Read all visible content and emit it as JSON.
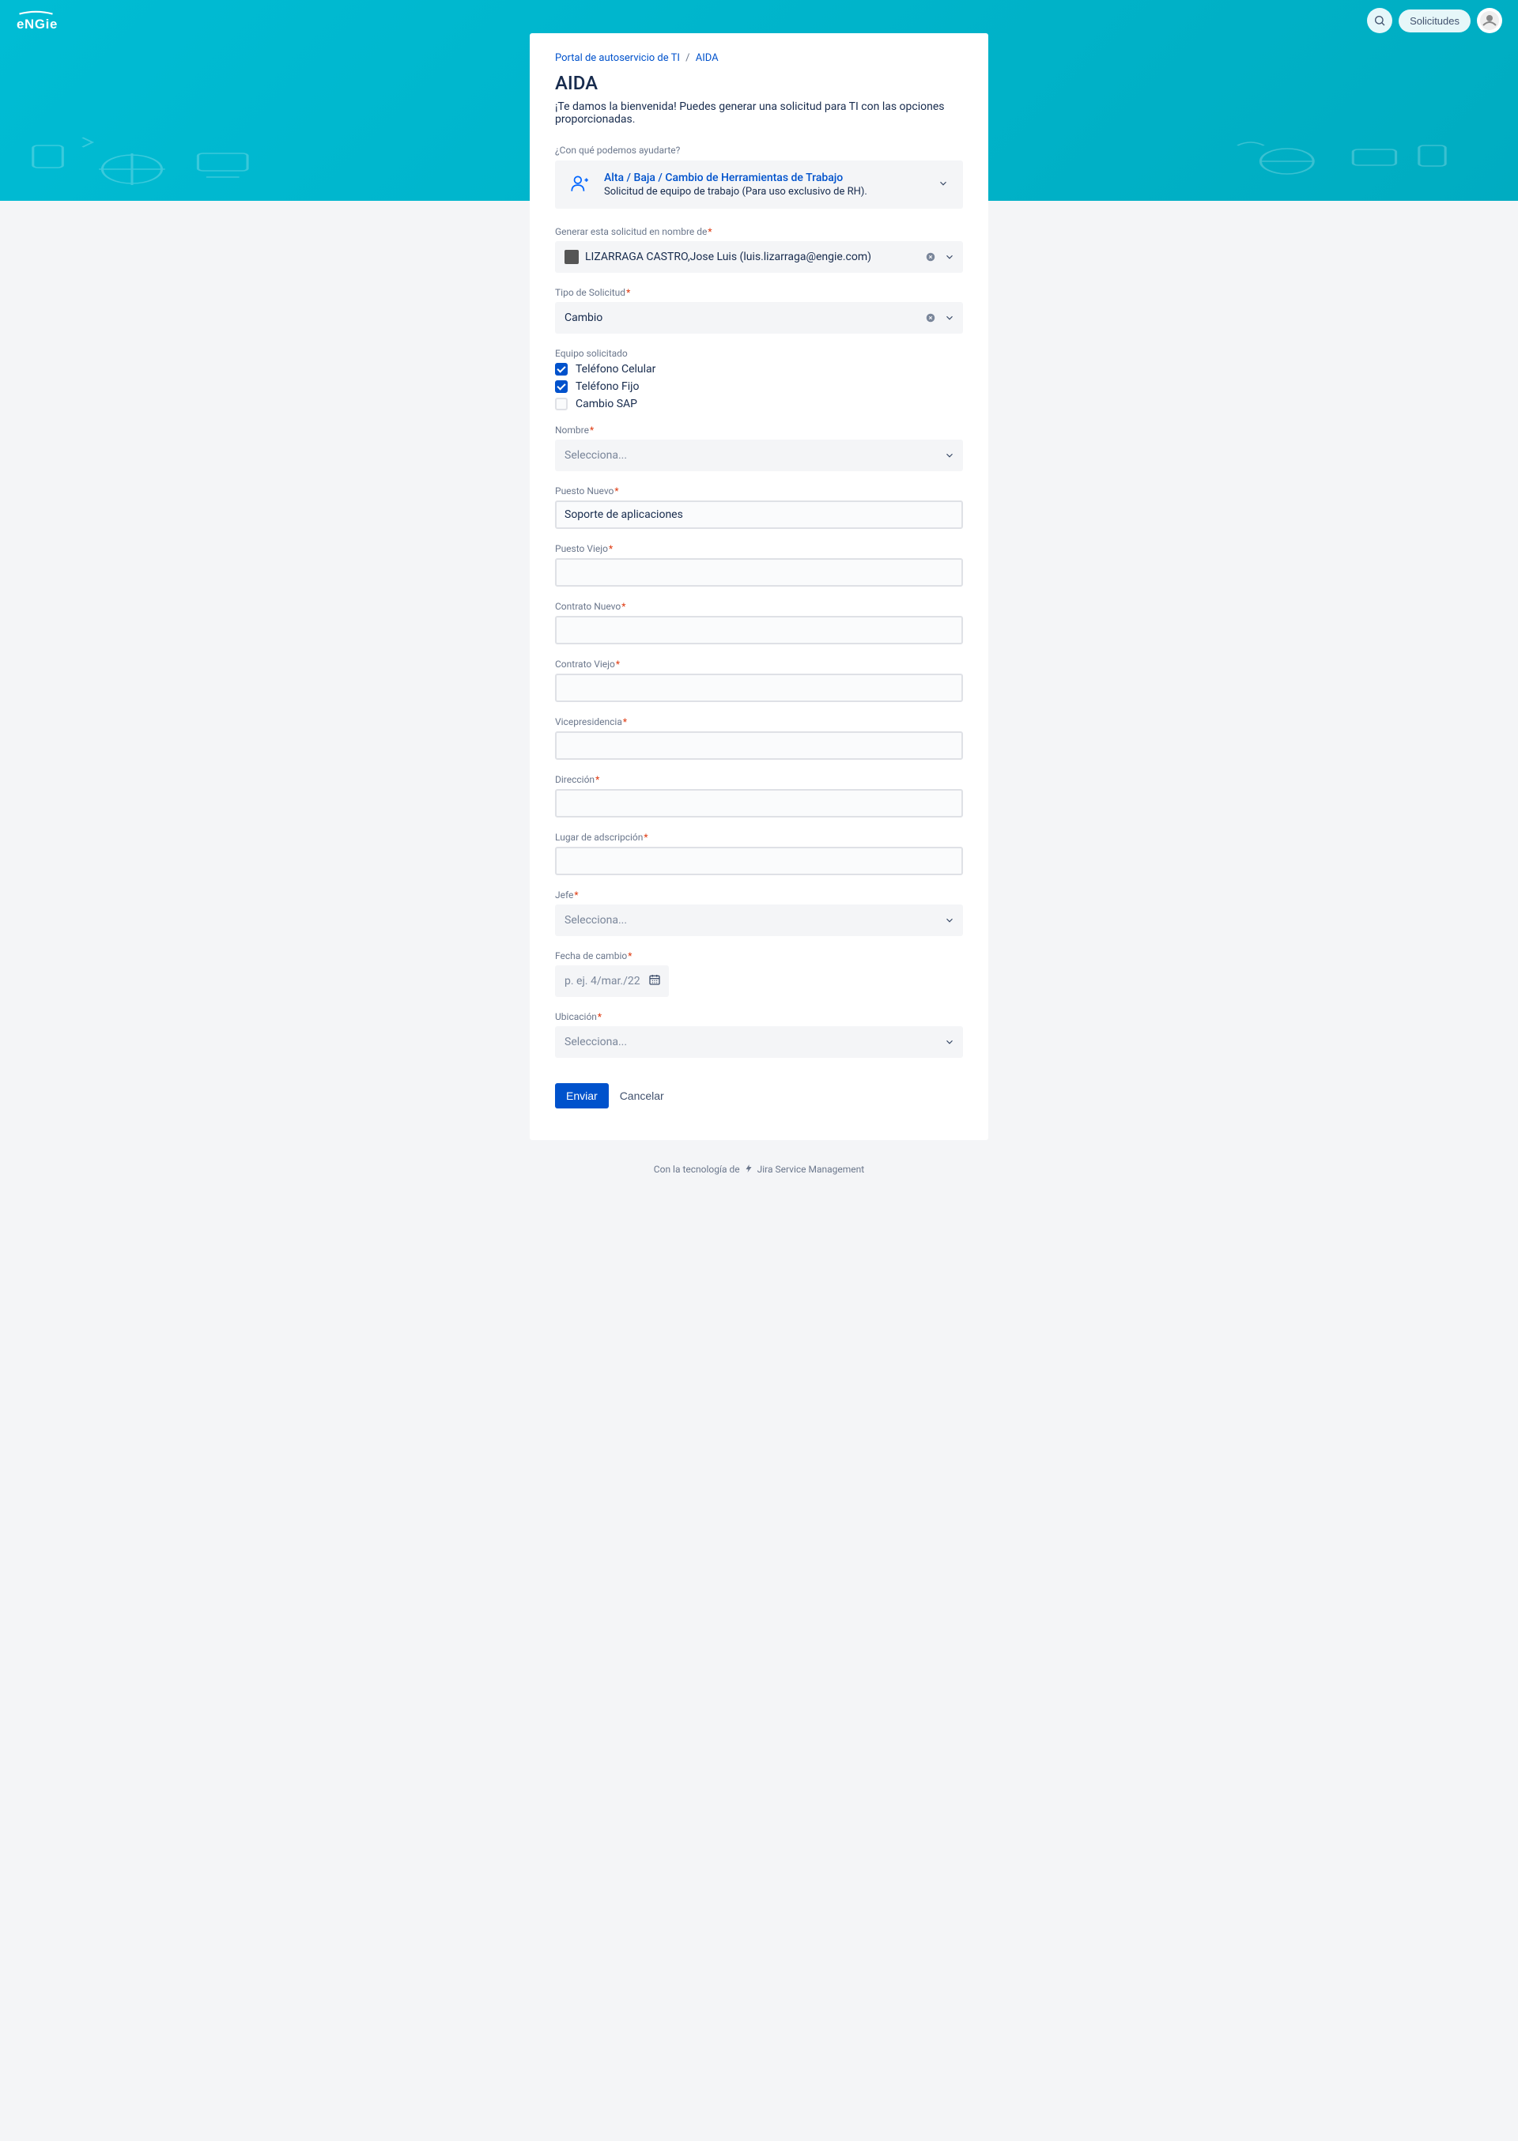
{
  "header": {
    "requests_button": "Solicitudes"
  },
  "breadcrumb": {
    "root": "Portal de autoservicio de TI",
    "current": "AIDA"
  },
  "page": {
    "title": "AIDA",
    "welcome": "¡Te damos la bienvenida! Puedes generar una solicitud para TI con las opciones proporcionadas."
  },
  "help_prompt": "¿Con qué podemos ayudarte?",
  "request_type": {
    "title": "Alta / Baja / Cambio de Herramientas de Trabajo",
    "desc": "Solicitud de equipo de trabajo (Para uso exclusivo de RH)."
  },
  "fields": {
    "on_behalf": {
      "label": "Generar esta solicitud en nombre de",
      "value": "LIZARRAGA CASTRO,Jose Luis (luis.lizarraga@engie.com)"
    },
    "tipo_solicitud": {
      "label": "Tipo de Solicitud",
      "value": "Cambio"
    },
    "equipo": {
      "label": "Equipo solicitado",
      "opt1": "Teléfono Celular",
      "opt2": "Teléfono Fijo",
      "opt3": "Cambio SAP"
    },
    "nombre": {
      "label": "Nombre",
      "placeholder": "Selecciona..."
    },
    "puesto_nuevo": {
      "label": "Puesto Nuevo",
      "value": "Soporte de aplicaciones"
    },
    "puesto_viejo": {
      "label": "Puesto Viejo"
    },
    "contrato_nuevo": {
      "label": "Contrato Nuevo"
    },
    "contrato_viejo": {
      "label": "Contrato Viejo"
    },
    "vicepresidencia": {
      "label": "Vicepresidencia"
    },
    "direccion": {
      "label": "Dirección"
    },
    "lugar": {
      "label": "Lugar de adscripción"
    },
    "jefe": {
      "label": "Jefe",
      "placeholder": "Selecciona..."
    },
    "fecha": {
      "label": "Fecha de cambio",
      "placeholder": "p. ej. 4/mar./22"
    },
    "ubicacion": {
      "label": "Ubicación",
      "placeholder": "Selecciona..."
    }
  },
  "actions": {
    "submit": "Enviar",
    "cancel": "Cancelar"
  },
  "footer": {
    "prefix": "Con la tecnología de",
    "product": "Jira Service Management"
  }
}
